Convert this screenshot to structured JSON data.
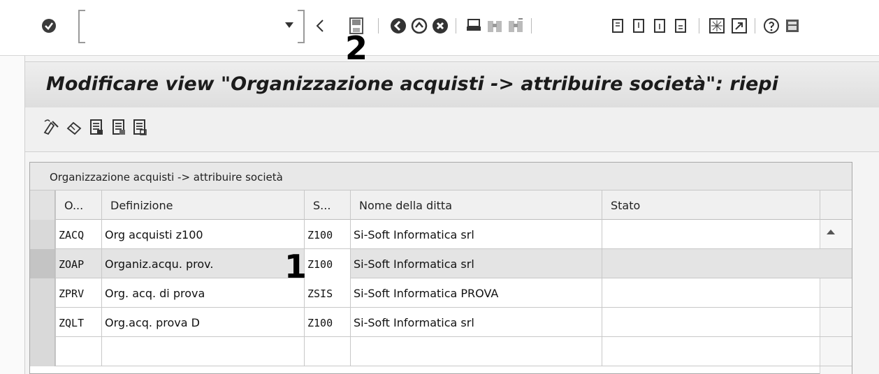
{
  "toolbar": {
    "command_field": {
      "value": "",
      "placeholder": ""
    },
    "icons": [
      "enter-checkmark-icon",
      "back-arrow-icon",
      "save-icon",
      "back-icon",
      "exit-icon",
      "cancel-icon",
      "print-icon",
      "find-icon",
      "find-next-icon",
      "first-page-icon",
      "previous-page-icon",
      "next-page-icon",
      "last-page-icon",
      "create-session-icon",
      "shortcut-icon",
      "help-icon",
      "customize-layout-icon"
    ]
  },
  "callouts": {
    "one": "1",
    "two": "2"
  },
  "title": "Modificare view \"Organizzazione acquisti -> attribuire società\": riepi",
  "app_toolbar": {
    "icons": [
      "display-change-icon",
      "undo-change-icon",
      "select-all-icon",
      "select-block-icon",
      "deselect-all-icon"
    ]
  },
  "table": {
    "caption": "Organizzazione acquisti -> attribuire società",
    "columns": [
      "O...",
      "Definizione",
      "S...",
      "Nome della ditta",
      "Stato"
    ],
    "rows": [
      {
        "org": "ZACQ",
        "definizione": "Org acquisti z100",
        "societa": "Z100",
        "nome": "Si-Soft Informatica srl",
        "stato": ""
      },
      {
        "org": "ZOAP",
        "definizione": "Organiz.acqu. prov.",
        "societa": "Z100",
        "nome": "Si-Soft Informatica srl",
        "stato": ""
      },
      {
        "org": "ZPRV",
        "definizione": "Org. acq. di prova",
        "societa": "ZSIS",
        "nome": "Si-Soft Informatica PROVA",
        "stato": ""
      },
      {
        "org": "ZQLT",
        "definizione": "Org.acq. prova D",
        "societa": "Z100",
        "nome": "Si-Soft Informatica srl",
        "stato": ""
      },
      {
        "org": "",
        "definizione": "",
        "societa": "",
        "nome": "",
        "stato": ""
      }
    ],
    "selected_row": 2
  },
  "colors": {
    "toolbar_bg": "#ffffff",
    "title_bg": "#e6e6e6",
    "selected_row": "#e4e4e4"
  }
}
